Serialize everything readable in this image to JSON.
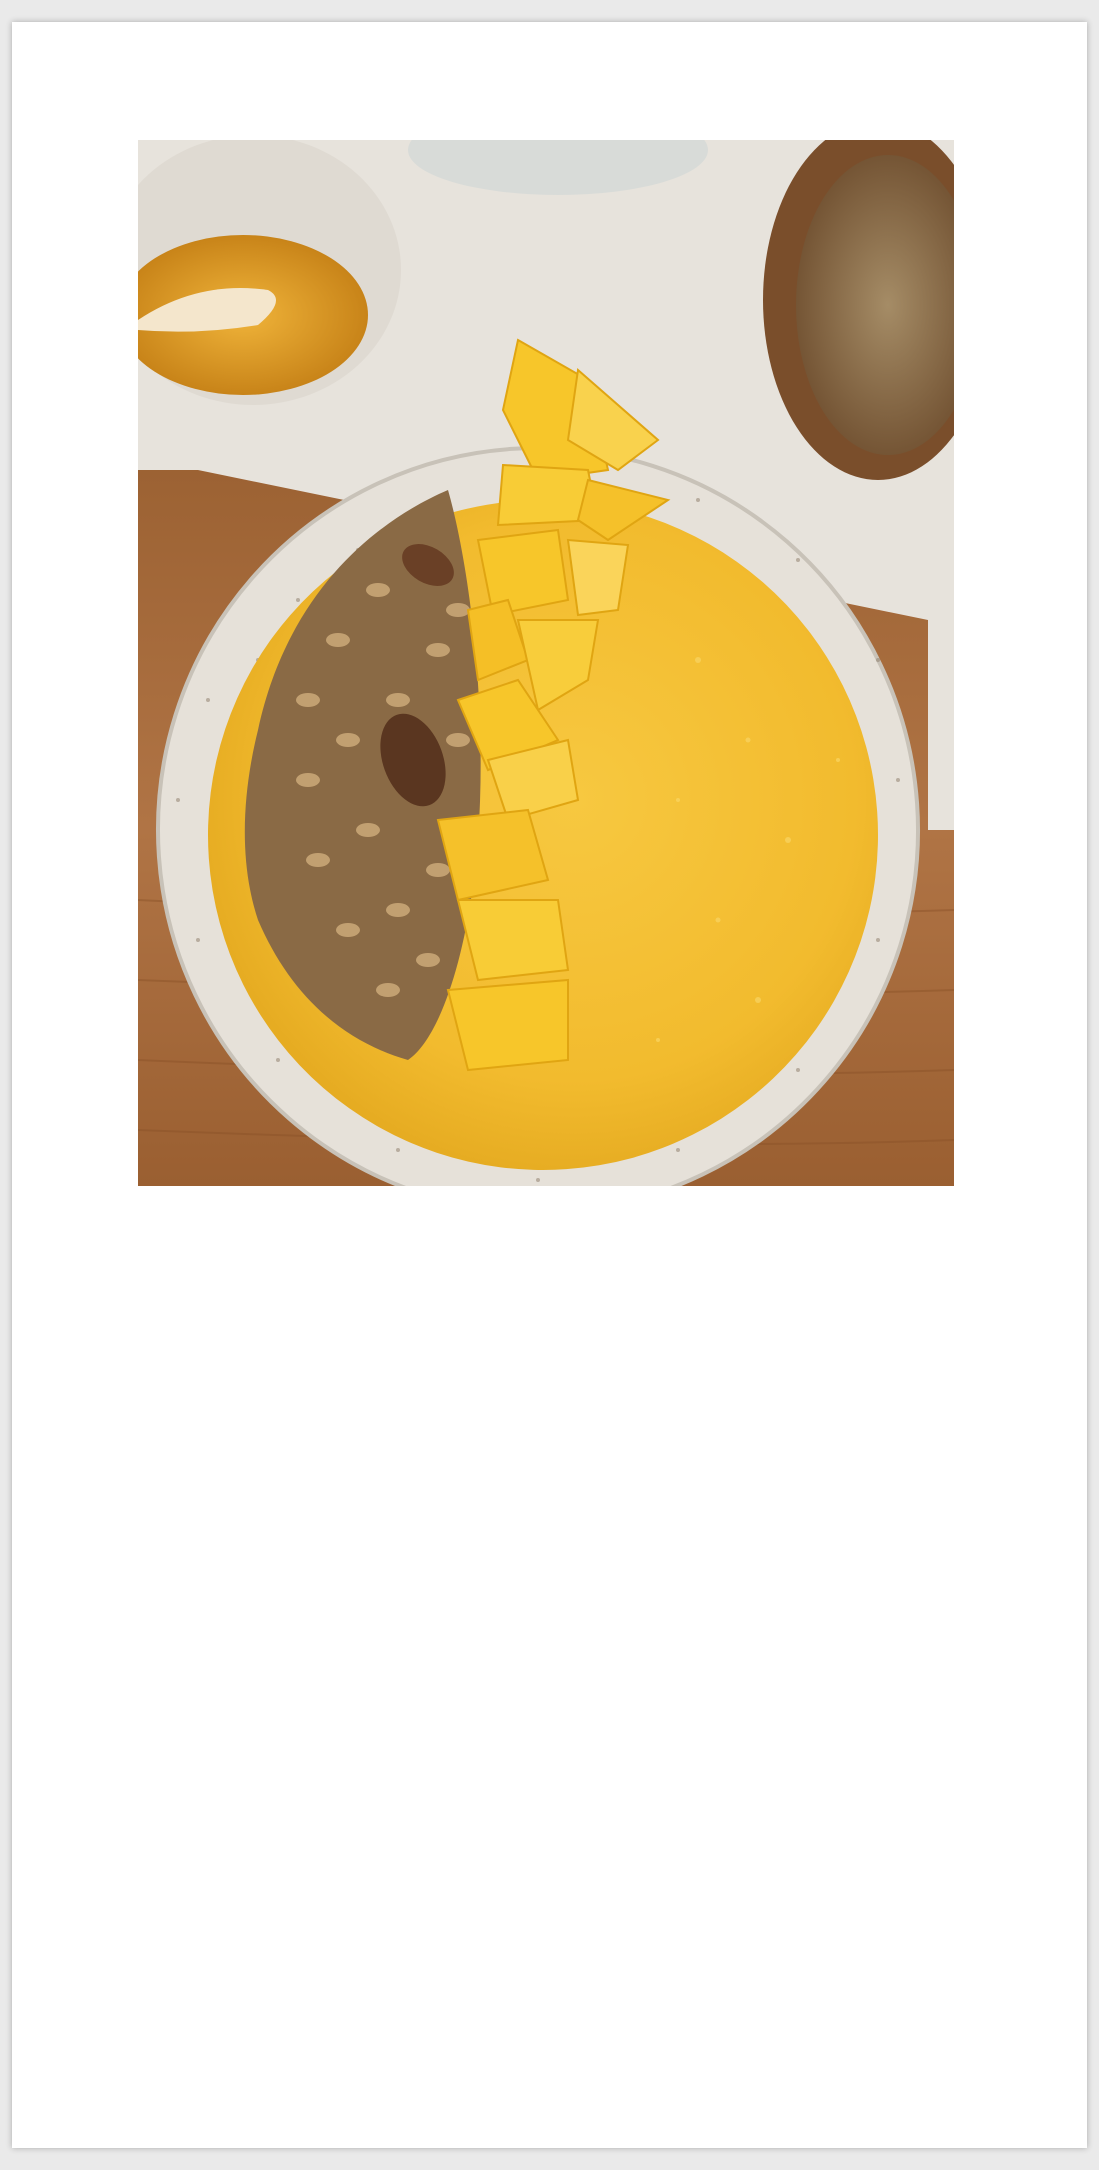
{
  "page": {
    "background": "#ffffff",
    "frame_shadow": "#bdbdbd"
  },
  "photo": {
    "subject_icon": "mango-smoothie-bowl-photo",
    "colors": {
      "smoothie": "#f4c033",
      "mango": "#f7c62a",
      "granola": "#8a6a45",
      "bowl_rim": "#e6e1d9",
      "board": "#a86a3b",
      "counter": "#e9e4dd",
      "honey": "#e1a21a"
    }
  }
}
